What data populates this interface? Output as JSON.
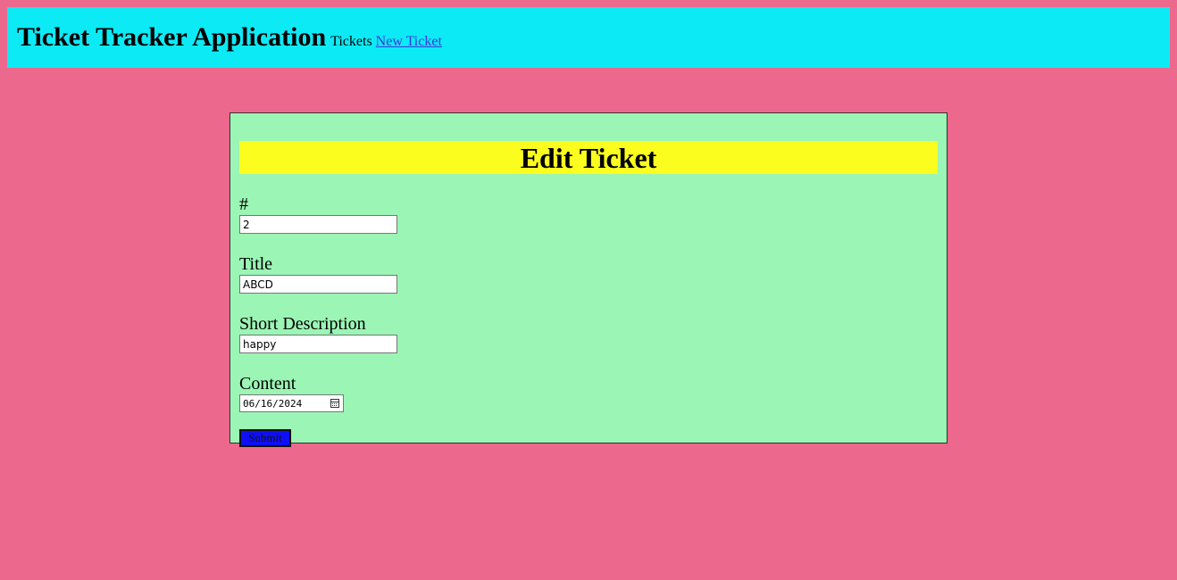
{
  "header": {
    "app_title": "Ticket Tracker Application",
    "nav_tickets": "Tickets",
    "nav_new_ticket": "New Ticket"
  },
  "form": {
    "heading": "Edit Ticket",
    "fields": [
      {
        "label": "#",
        "value": "2"
      },
      {
        "label": "Title",
        "value": "ABCD"
      },
      {
        "label": "Short Description",
        "value": "happy"
      },
      {
        "label": "Content",
        "value": "06/16/2024"
      }
    ],
    "submit_label": "Submit"
  },
  "colors": {
    "page_background": "#ec688d",
    "header_background": "#0ceaf6",
    "card_background": "#9bf5b4",
    "heading_background": "#fafd1e",
    "submit_background": "#0f0ff6"
  },
  "icons": {
    "date_picker": "calendar-icon"
  }
}
